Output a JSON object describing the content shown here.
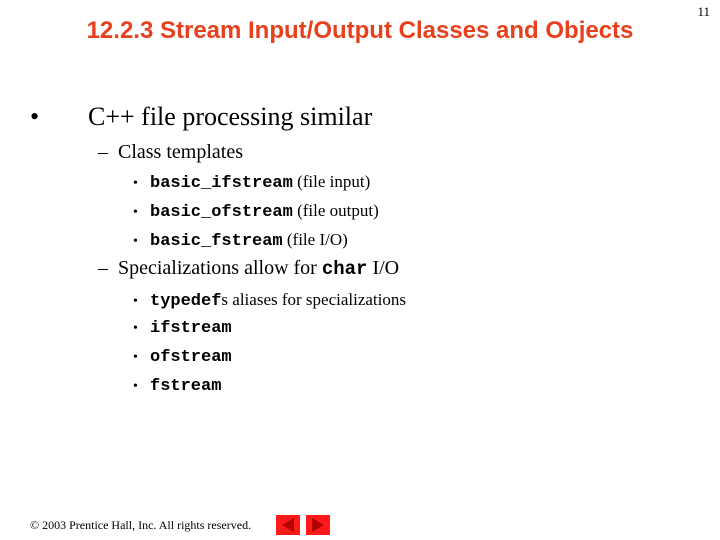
{
  "slide": {
    "page_number": "11",
    "title": "12.2.3 Stream Input/Output Classes and Objects",
    "bullet_char": "•",
    "dash_char": "–",
    "point1": "C++ file processing similar",
    "class_templates": {
      "label": "Class templates",
      "items": [
        {
          "code": "basic_ifstream",
          "desc": "(file input)"
        },
        {
          "code": "basic_ofstream",
          "desc": "(file output)"
        },
        {
          "code": "basic_fstream",
          "desc": "(file I/O)"
        }
      ]
    },
    "specializations": {
      "label_pre": "Specializations allow for ",
      "label_code": "char",
      "label_post": " I/O",
      "typedef_code": "typedef",
      "typedef_text": "s aliases for specializations",
      "items": [
        "ifstream",
        "ofstream",
        "fstream"
      ]
    },
    "footer": {
      "copyright": "© 2003 Prentice Hall, Inc.  All rights reserved."
    },
    "nav": {
      "prev_icon": "left-triangle",
      "next_icon": "right-triangle",
      "color": "#ff1a1a"
    },
    "colors": {
      "title": "#e8401c"
    }
  }
}
